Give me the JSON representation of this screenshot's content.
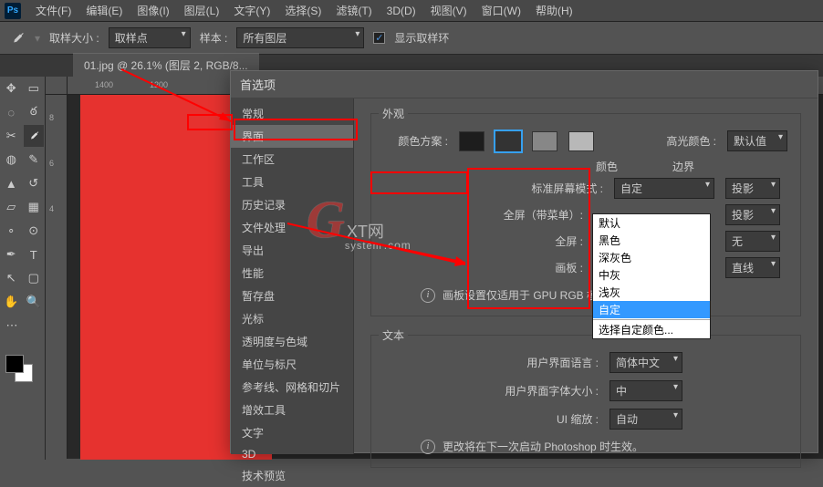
{
  "menubar": {
    "ps": "Ps",
    "items": [
      "文件(F)",
      "编辑(E)",
      "图像(I)",
      "图层(L)",
      "文字(Y)",
      "选择(S)",
      "滤镜(T)",
      "3D(D)",
      "视图(V)",
      "窗口(W)",
      "帮助(H)"
    ]
  },
  "optionsbar": {
    "sample_size_label": "取样大小 :",
    "sample_size_value": "取样点",
    "sample_label": "样本 :",
    "sample_value": "所有图层",
    "show_ring_label": "显示取样环",
    "show_ring_checked": "✓"
  },
  "tab": {
    "title": "01.jpg @ 26.1% (图层 2, RGB/8..."
  },
  "ruler_h": [
    "1400",
    "1200"
  ],
  "ruler_v": [
    "8",
    "6",
    "4"
  ],
  "prefs": {
    "title": "首选项",
    "sidebar": [
      "常规",
      "界面",
      "工作区",
      "工具",
      "历史记录",
      "文件处理",
      "导出",
      "性能",
      "暂存盘",
      "光标",
      "透明度与色域",
      "单位与标尺",
      "参考线、网格和切片",
      "增效工具",
      "文字",
      "3D",
      "技术预览"
    ],
    "sidebar_selected": 1,
    "appearance": {
      "legend": "外观",
      "scheme_label": "颜色方案 :",
      "scheme_colors": [
        "#1d1d1d",
        "#333333",
        "#878787",
        "#b8b8b8"
      ],
      "scheme_active": 1,
      "highlight_label": "高光颜色 :",
      "highlight_value": "默认值",
      "col_color": "颜色",
      "col_border": "边界",
      "rows": [
        {
          "label": "标准屏幕模式 :",
          "color": "自定",
          "border": "投影"
        },
        {
          "label": "全屏（带菜单）:",
          "color": "",
          "border": "投影"
        },
        {
          "label": "全屏 :",
          "color": "",
          "border": "无"
        },
        {
          "label": "画板 :",
          "color": "",
          "border": "直线"
        }
      ],
      "gpu_note": "画板设置仅适用于 GPU RGB 模式。"
    },
    "dropdown": {
      "options": [
        "默认",
        "黑色",
        "深灰色",
        "中灰",
        "浅灰",
        "自定",
        "选择自定颜色..."
      ],
      "highlight_index": 5
    },
    "text": {
      "legend": "文本",
      "lang_label": "用户界面语言 :",
      "lang_value": "简体中文",
      "font_label": "用户界面字体大小 :",
      "font_value": "中",
      "scale_label": "UI 缩放 :",
      "scale_value": "自动",
      "restart_note": "更改将在下一次启动 Photoshop 时生效。"
    }
  },
  "watermark": {
    "g": "G",
    "rest": "XT网",
    "sub": "system",
    "com": ".com"
  }
}
